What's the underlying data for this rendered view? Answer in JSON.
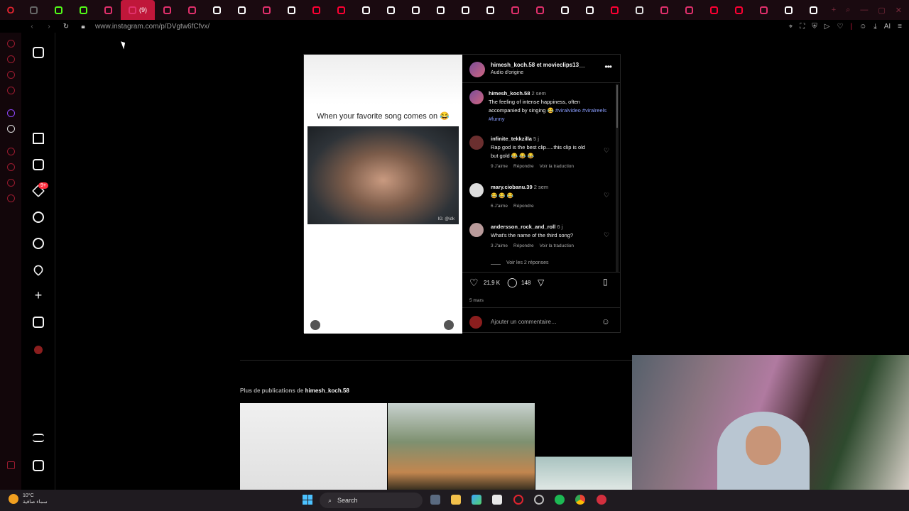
{
  "browser": {
    "tabs": [
      {
        "icon": "opera-tab-icon"
      },
      {
        "icon": "kick-icon",
        "color": "#53fc18"
      },
      {
        "icon": "kick-icon",
        "color": "#53fc18"
      },
      {
        "icon": "instagram-icon",
        "color": "#e1306c"
      },
      {
        "icon": "instagram-icon",
        "color": "#e1306c",
        "active": true,
        "badge": "(9)"
      },
      {
        "icon": "instagram-icon",
        "color": "#e1306c"
      },
      {
        "icon": "instagram-icon",
        "color": "#e1306c"
      },
      {
        "icon": "tiktok-icon",
        "color": "#ffffff"
      },
      {
        "icon": "tiktok-icon",
        "color": "#ffffff"
      },
      {
        "icon": "instagram-icon",
        "color": "#e1306c"
      },
      {
        "icon": "tiktok-icon",
        "color": "#ffffff"
      },
      {
        "icon": "youtube-icon",
        "color": "#ff0033"
      },
      {
        "icon": "youtube-icon",
        "color": "#ff0033"
      },
      {
        "icon": "tiktok-icon",
        "color": "#ffffff"
      },
      {
        "icon": "tiktok-icon",
        "color": "#ffffff"
      },
      {
        "icon": "tiktok-icon",
        "color": "#ffffff"
      },
      {
        "icon": "tiktok-icon",
        "color": "#ffffff"
      },
      {
        "icon": "tiktok-icon",
        "color": "#ffffff"
      },
      {
        "icon": "tiktok-icon",
        "color": "#ffffff"
      },
      {
        "icon": "instagram-icon",
        "color": "#e1306c"
      },
      {
        "icon": "instagram-icon",
        "color": "#e1306c"
      },
      {
        "icon": "tiktok-icon",
        "color": "#ffffff"
      },
      {
        "icon": "tiktok-icon",
        "color": "#ffffff"
      },
      {
        "icon": "youtube-icon",
        "color": "#ff0033"
      },
      {
        "icon": "generic-icon",
        "color": "#dddddd"
      },
      {
        "icon": "instagram-icon",
        "color": "#e1306c"
      },
      {
        "icon": "instagram-icon",
        "color": "#e1306c"
      },
      {
        "icon": "youtube-icon",
        "color": "#ff0033"
      },
      {
        "icon": "youtube-icon",
        "color": "#ff0033"
      },
      {
        "icon": "instagram-icon",
        "color": "#e1306c"
      },
      {
        "icon": "tiktok-icon",
        "color": "#ffffff"
      },
      {
        "icon": "tiktok-icon",
        "color": "#ffffff"
      }
    ],
    "active_tab_badge": "(9)",
    "url": "www.instagram.com/p/DVgtw6fCfvx/",
    "ai_label": "AI"
  },
  "post": {
    "media_caption": "When your favorite song comes on 😂",
    "media_watermark": "IG: @idk",
    "author_line": "himesh_koch.58 et movieclips13__",
    "audio": "Audio d'origine",
    "caption": {
      "user": "himesh_koch.58",
      "time": "2 sem",
      "text": "The feeling of intense happiness, often accompanied by singing 😂",
      "tags": "#viralvideo #viralreels #funny"
    },
    "comments": [
      {
        "user": "infinite_tekkzilla",
        "time": "5 j",
        "text": "Rap god is the best clip.....this clip is old but gold 😂 😂 😂",
        "likes": "9 J'aime",
        "reply": "Répondre",
        "translate": "Voir la traduction"
      },
      {
        "user": "mary.ciobanu.39",
        "time": "2 sem",
        "text": "😂 😂 😂",
        "likes": "6 J'aime",
        "reply": "Répondre",
        "translate": ""
      },
      {
        "user": "andersson_rock_and_roll",
        "time": "6 j",
        "text": "What's the name of the third song?",
        "likes": "3 J'aime",
        "reply": "Répondre",
        "translate": "Voir la traduction"
      }
    ],
    "view_replies": "Voir les 2 réponses",
    "like_count": "21,9 K",
    "comment_count": "148",
    "date": "5 mars",
    "add_comment_placeholder": "Ajouter un commentaire…"
  },
  "more_publications": {
    "label": "Plus de publications de",
    "user": "himesh_koch.58"
  },
  "taskbar": {
    "temp": "10°C",
    "weather": "سماء صافية",
    "search": "Search"
  }
}
